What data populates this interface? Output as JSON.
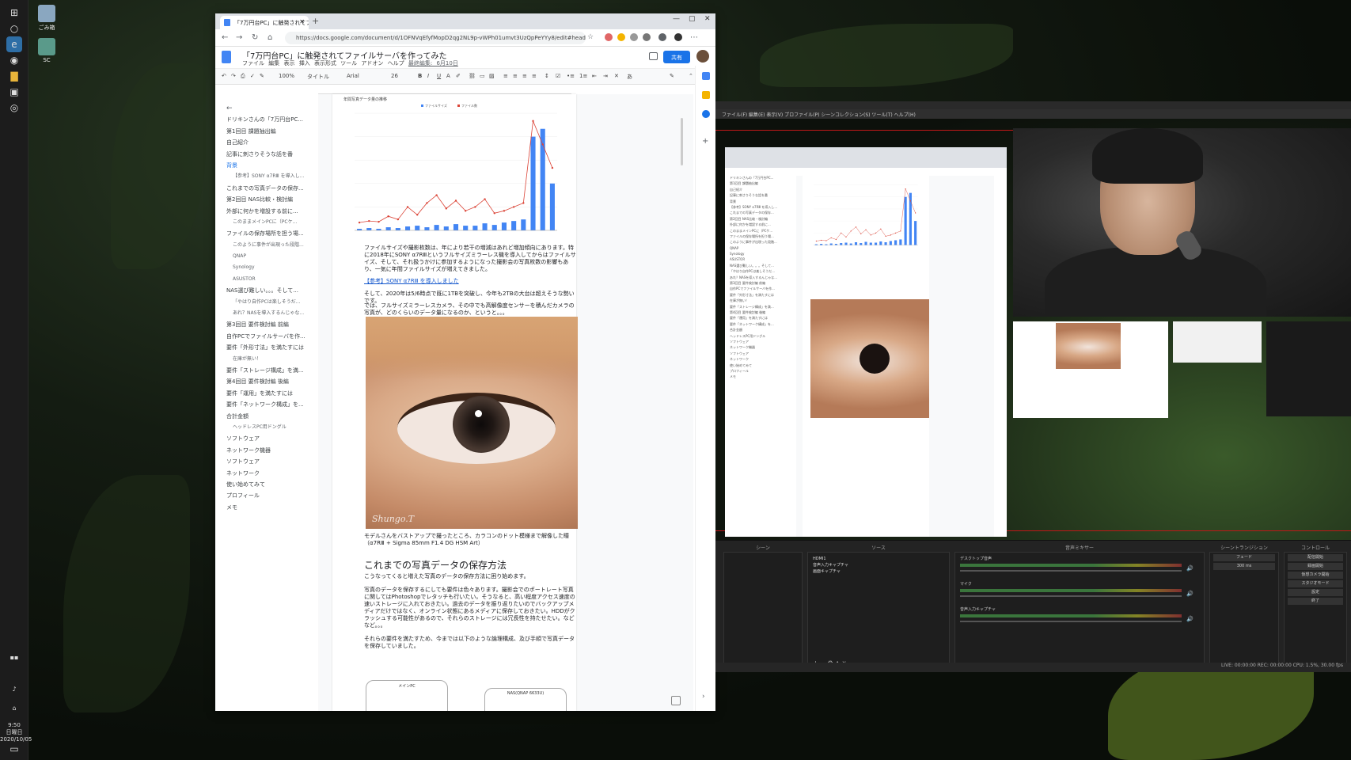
{
  "desktop": {
    "icons": [
      {
        "label": "ごみ箱"
      },
      {
        "label": "SC"
      }
    ],
    "clock": {
      "time": "9:50",
      "day": "日曜日",
      "date": "2020/10/05"
    }
  },
  "browser": {
    "tab_title": "「7万円台PC」に触発されてファイルサ...",
    "url": "https://docs.google.com/document/d/1OFNVqEfyfMopD2qg2NL9p-vWPh01umvt3UzQpPeYYy8/edit#heading=h...",
    "doc_title": "「7万円台PC」に触発されてファイルサーバを作ってみた",
    "menu": [
      "ファイル",
      "編集",
      "表示",
      "挿入",
      "表示形式",
      "ツール",
      "アドオン",
      "ヘルプ",
      "最終編集: 6月10日"
    ],
    "share_label": "共有",
    "format": {
      "zoom": "100%",
      "style": "タイトル",
      "font": "Arial",
      "size": "26"
    },
    "outline": [
      {
        "text": "ドリキンさんの「7万円台PC...",
        "level": 1
      },
      {
        "text": "第1回目 課題抽出編",
        "level": 1
      },
      {
        "text": "自己紹介",
        "level": 1
      },
      {
        "text": "記事に刺さりそうな話を番",
        "level": 1
      },
      {
        "text": "背景",
        "level": 1,
        "active": true
      },
      {
        "text": "【参考】SONY α7RⅢ を導入し...",
        "level": 2
      },
      {
        "text": "これまでの写真データの保存...",
        "level": 1
      },
      {
        "text": "第2回目 NAS比較・検討編",
        "level": 1
      },
      {
        "text": "外部に何かを増設する前に...",
        "level": 1
      },
      {
        "text": "このままメインPCに（PCケ...",
        "level": 2
      },
      {
        "text": "ファイルの保存場所を担う場...",
        "level": 1
      },
      {
        "text": "このように事件が出現った段階...",
        "level": 2
      },
      {
        "text": "QNAP",
        "level": 2
      },
      {
        "text": "Synology",
        "level": 2
      },
      {
        "text": "ASUSTOR",
        "level": 2
      },
      {
        "text": "NAS選び難しい。。。そして...",
        "level": 1
      },
      {
        "text": "「やはり自作PCは楽しそうだ...",
        "level": 2
      },
      {
        "text": "あれ？NASを導入するんじゃな...",
        "level": 2
      },
      {
        "text": "第3回目 要件検討編 前編",
        "level": 1
      },
      {
        "text": "自作PCでファイルサーバを作...",
        "level": 1
      },
      {
        "text": "要件「外形寸法」を満たすには",
        "level": 1
      },
      {
        "text": "在庫が無い！",
        "level": 2
      },
      {
        "text": "要件「ストレージ構成」を満...",
        "level": 1
      },
      {
        "text": "第4回目 要件検討編 後編",
        "level": 1
      },
      {
        "text": "要件「運用」を満たすには",
        "level": 1
      },
      {
        "text": "要件「ネットワーク構成」を...",
        "level": 1
      },
      {
        "text": "合計金額",
        "level": 1
      },
      {
        "text": "ヘッドレスPC用ドングル",
        "level": 2
      },
      {
        "text": "ソフトウェア",
        "level": 1
      },
      {
        "text": "ネットワーク機器",
        "level": 1
      },
      {
        "text": "ソフトウェア",
        "level": 1
      },
      {
        "text": "ネットワーク",
        "level": 1
      },
      {
        "text": "使い始めてみて",
        "level": 1
      },
      {
        "text": "プロフィール",
        "level": 1
      },
      {
        "text": "メモ",
        "level": 1
      }
    ],
    "page": {
      "para1": "ファイルサイズや撮影枚数は、年により若干の増減はあれど増加傾向にあります。特に2018年にSONY α7RⅢというフルサイズミラーレス機を導入してからはファイルサイズ、そして、それ扱うかけに参加するようになった撮影会の写真枚数の影響もあり、一気に年間ファイルサイズが増えてきました。",
      "link1": "【参考】SONY α7RⅢ を導入しました",
      "para2": "そして、2020年は5/6時点で既に1TBを突破し、今年も2TBの大台は超えそうな勢いです。",
      "para3": "では、フルサイズミラーレスカメラ、その中でも高解像度センサーを積んだカメラの写真が、どのくらいのデータ量になるのか、というと。。。",
      "watermark": "Shungo.T",
      "caption": "モデルさんをバストアップで撮ったところ、カラコンのドット模様まで解像した瞳（α7RⅢ + Sigma 85mm F1.4 DG HSM Art）",
      "heading": "これまでの写真データの保存方法",
      "para4": "こうなってくると増えた写真のデータの保存方法に困り始めます。",
      "para5": "写真のデータを保存するにしても要件は色々あります。撮影会でのポートレート写真に関してはPhotoshopでレタッチも行いたい。そうなると、高い程度アクセス速度の速いストレージに入れておきたい。過去のデータを振り返りたいのでバックアップメディアだけではなく、オンライン状態にあるメディアに保存しておきたい。HDDがクラッシュする可能性があるので、それらのストレージには冗長性を持たせたい。などなど。。。",
      "para6": "それらの要件を満たすため、今までは以下のような論理構成、及び手順で写真データを保存していました。",
      "card1": "メインPC",
      "card2": "NAS(QNAP 6633U)"
    }
  },
  "chart_data": {
    "type": "bar",
    "title": "年間写真データ量の推移",
    "legend": [
      "ファイルサイズ",
      "ファイル数"
    ],
    "legend_position": "top",
    "categories": [
      "1",
      "2",
      "3",
      "4",
      "5",
      "6",
      "7",
      "8",
      "9",
      "10",
      "11",
      "12",
      "13",
      "14",
      "15",
      "16",
      "17",
      "18",
      "19",
      "20",
      "21"
    ],
    "series": [
      {
        "name": "ファイルサイズ",
        "type": "bar",
        "color": "#4285f4",
        "values": [
          2,
          3,
          2,
          4,
          3,
          5,
          6,
          4,
          7,
          5,
          8,
          6,
          6,
          9,
          7,
          10,
          12,
          14,
          120,
          130,
          60
        ]
      },
      {
        "name": "ファイル数",
        "type": "line",
        "color": "#db4437",
        "values": [
          10,
          12,
          11,
          18,
          14,
          30,
          20,
          35,
          45,
          28,
          38,
          25,
          30,
          40,
          22,
          25,
          30,
          35,
          140,
          110,
          80
        ]
      }
    ],
    "ylim": [
      0,
      150
    ]
  },
  "obs": {
    "menu": "ファイル(F)  編集(E)  表示(V)  プロファイル(P)  シーンコレクション(S)  ツール(T)  ヘルプ(H)",
    "docks": {
      "scenes": "シーン",
      "sources": "ソース",
      "mixer": "音声ミキサー",
      "transitions": "シーントランジション",
      "controls": "コントロール"
    },
    "sources": [
      "HDMI1",
      "音声入力キャプチャ",
      "画面キャプチャ"
    ],
    "mixer": [
      "デスクトップ音声",
      "マイク",
      "音声入力キャプチャ"
    ],
    "transition": {
      "type": "フェード",
      "duration": "300 ms"
    },
    "controls": [
      "配信開始",
      "録画開始",
      "仮想カメラ開始",
      "スタジオモード",
      "設定",
      "終了"
    ],
    "status": "LIVE: 00:00:00   REC: 00:00:00   CPU: 1.5%, 30.00 fps"
  }
}
